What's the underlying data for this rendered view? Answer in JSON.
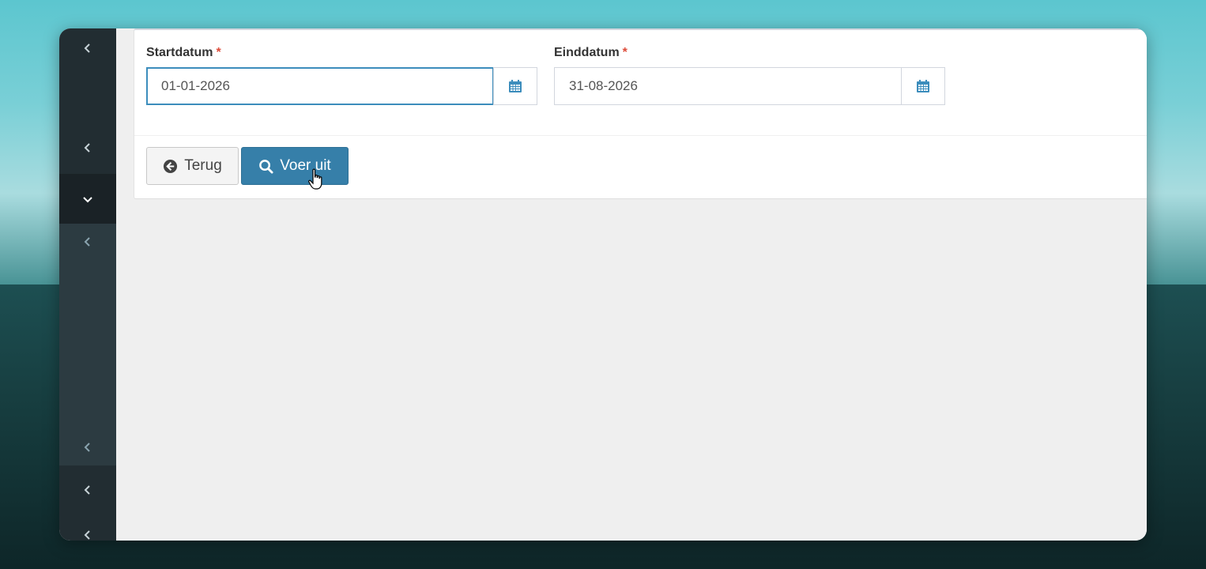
{
  "form": {
    "start_label": "Startdatum",
    "start_value": "01-01-2026",
    "end_label": "Einddatum",
    "end_value": "31-08-2026",
    "required_marker": "*"
  },
  "actions": {
    "back_label": "Terug",
    "run_label": "Voer uit"
  },
  "sidebar": {
    "icons": [
      "chevron-left-icon",
      "chevron-left-icon",
      "chevron-down-icon",
      "chevron-left-icon",
      "chevron-left-icon",
      "chevron-left-icon",
      "chevron-left-icon"
    ]
  },
  "colors": {
    "primary": "#367fa9",
    "focus": "#3c8dbc",
    "required": "#dd4b39",
    "sidebar": "#222d32"
  }
}
